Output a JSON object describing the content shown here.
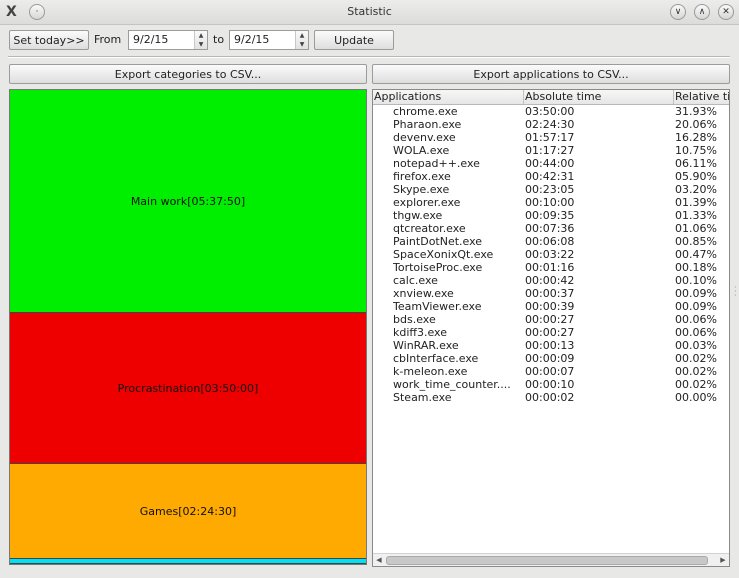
{
  "window": {
    "title": "Statistic",
    "app_icon": "X",
    "menu_icon": "·",
    "minimize_icon": "∨",
    "maximize_icon": "∧",
    "close_icon": "✕"
  },
  "toolbar": {
    "set_today_label": "Set today>>",
    "from_label": "From",
    "from_date": "9/2/15",
    "to_label": "to",
    "to_date": "9/2/15",
    "update_label": "Update"
  },
  "export": {
    "categories_label": "Export categories to CSV...",
    "applications_label": "Export applications to CSV..."
  },
  "categories": [
    {
      "label": "Main work[05:37:50]",
      "color": "#00ee00",
      "fraction": 0.4704
    },
    {
      "label": "Procrastination[03:50:00]",
      "color": "#ee0000",
      "fraction": 0.3193
    },
    {
      "label": "Games[02:24:30]",
      "color": "#ffaa00",
      "fraction": 0.2006
    },
    {
      "label": "",
      "color": "#00e0f0",
      "fraction": 0.0097
    }
  ],
  "table": {
    "headers": [
      "Applications",
      "Absolute time",
      "Relative ti"
    ],
    "rows": [
      [
        "chrome.exe",
        "03:50:00",
        "31.93%"
      ],
      [
        "Pharaon.exe",
        "02:24:30",
        "20.06%"
      ],
      [
        "devenv.exe",
        "01:57:17",
        "16.28%"
      ],
      [
        "WOLA.exe",
        "01:17:27",
        "10.75%"
      ],
      [
        "notepad++.exe",
        "00:44:00",
        "06.11%"
      ],
      [
        "firefox.exe",
        "00:42:31",
        "05.90%"
      ],
      [
        "Skype.exe",
        "00:23:05",
        "03.20%"
      ],
      [
        "explorer.exe",
        "00:10:00",
        "01.39%"
      ],
      [
        "thgw.exe",
        "00:09:35",
        "01.33%"
      ],
      [
        "qtcreator.exe",
        "00:07:36",
        "01.06%"
      ],
      [
        "PaintDotNet.exe",
        "00:06:08",
        "00.85%"
      ],
      [
        "SpaceXonixQt.exe",
        "00:03:22",
        "00.47%"
      ],
      [
        "TortoiseProc.exe",
        "00:01:16",
        "00.18%"
      ],
      [
        "calc.exe",
        "00:00:42",
        "00.10%"
      ],
      [
        "xnview.exe",
        "00:00:37",
        "00.09%"
      ],
      [
        "TeamViewer.exe",
        "00:00:39",
        "00.09%"
      ],
      [
        "bds.exe",
        "00:00:27",
        "00.06%"
      ],
      [
        "kdiff3.exe",
        "00:00:27",
        "00.06%"
      ],
      [
        "WinRAR.exe",
        "00:00:13",
        "00.03%"
      ],
      [
        "cbInterface.exe",
        "00:00:09",
        "00.02%"
      ],
      [
        "k-meleon.exe",
        "00:00:07",
        "00.02%"
      ],
      [
        "work_time_counter....",
        "00:00:10",
        "00.02%"
      ],
      [
        "Steam.exe",
        "00:00:02",
        "00.00%"
      ]
    ]
  },
  "scroll": {
    "left_icon": "◀",
    "right_icon": "▶"
  }
}
